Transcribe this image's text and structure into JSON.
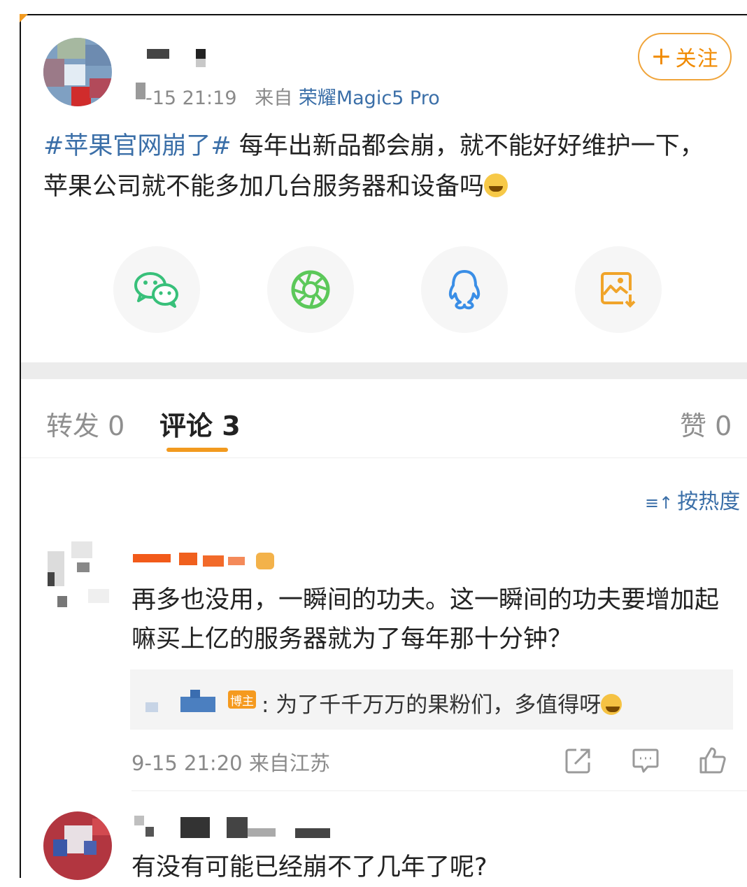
{
  "post": {
    "meta_time": "-15 21:19",
    "meta_from": "来自",
    "meta_source": "荣耀Magic5 Pro",
    "follow_label": "关注",
    "topic": "#苹果官网崩了#",
    "text": " 每年出新品都会崩，就不能好好维护一下，苹果公司就不能多加几台服务器和设备吗",
    "emoji": "laughing-tears-emoji"
  },
  "share": {
    "items": [
      {
        "name": "wechat-icon",
        "color": "#38c07a"
      },
      {
        "name": "moments-icon",
        "color": "#5cc85a"
      },
      {
        "name": "qq-icon",
        "color": "#3a8ee6"
      },
      {
        "name": "save-image-icon",
        "color": "#f0a42a"
      }
    ]
  },
  "tabs": {
    "repost": "转发 0",
    "comments": "评论 3",
    "likes": "赞 0"
  },
  "sort": {
    "label": "按热度"
  },
  "comments": [
    {
      "text": "再多也没用，一瞬间的功夫。这一瞬间的功夫要增加起嘛买上亿的服务器就为了每年那十分钟？",
      "reply_badge": "博主",
      "reply_text": ": 为了千千万万的果粉们，多值得呀",
      "time": "9-15 21:20",
      "location": "来自江苏"
    },
    {
      "text": "有没有可能已经崩不了几年了呢?"
    }
  ],
  "colors": {
    "accent": "#f29a1f",
    "link": "#3b6fa8"
  }
}
